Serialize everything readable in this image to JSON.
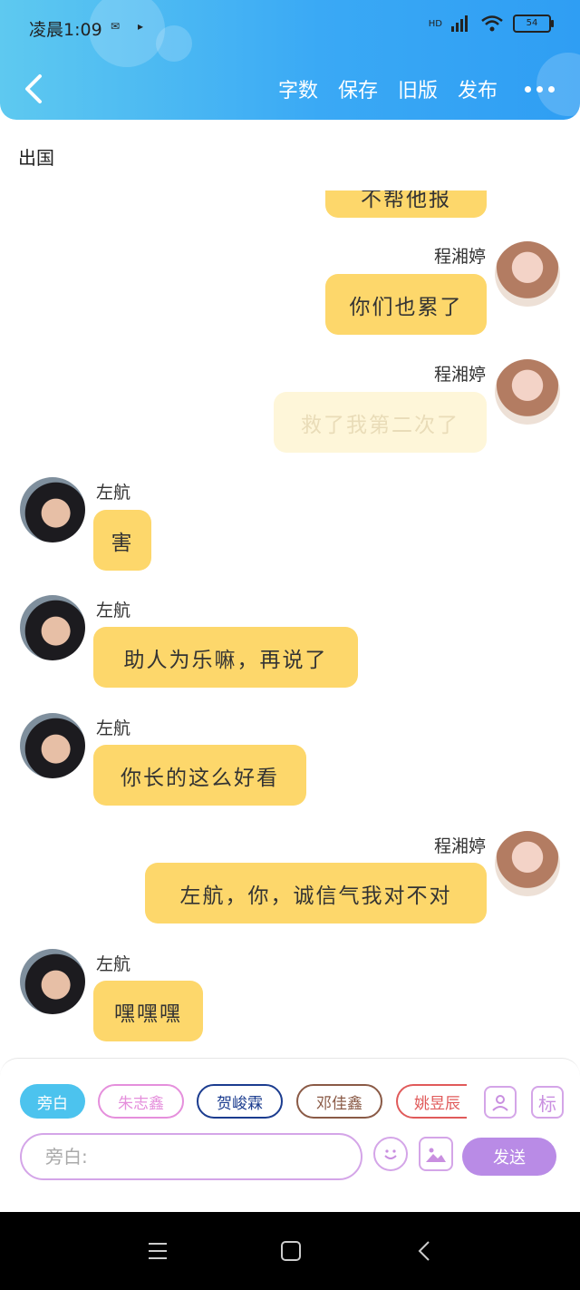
{
  "status_bar": {
    "time": "凌晨1:09",
    "battery": "54",
    "network": "HD"
  },
  "header": {
    "menu": [
      "字数",
      "保存",
      "旧版",
      "发布"
    ]
  },
  "chat": {
    "title": "出国",
    "messages": [
      {
        "side": "right",
        "name": "",
        "text": "不帮他报",
        "partial": true
      },
      {
        "side": "right",
        "name": "程湘婷",
        "text": "你们也累了"
      },
      {
        "side": "right",
        "name": "程湘婷",
        "text": "救了我第二次了",
        "faded": true
      },
      {
        "side": "left",
        "name": "左航",
        "text": "害"
      },
      {
        "side": "left",
        "name": "左航",
        "text": "助人为乐嘛，再说了"
      },
      {
        "side": "left",
        "name": "左航",
        "text": "你长的这么好看"
      },
      {
        "side": "right",
        "name": "程湘婷",
        "text": "左航，你，诚信气我对不对"
      },
      {
        "side": "left",
        "name": "左航",
        "text": "嘿嘿嘿"
      }
    ]
  },
  "composer": {
    "tags": [
      {
        "label": "旁白",
        "color": "#4cc3ee"
      },
      {
        "label": "朱志鑫",
        "color": "#e58fdc"
      },
      {
        "label": "贺峻霖",
        "color": "#1b3c8f"
      },
      {
        "label": "邓佳鑫",
        "color": "#8a5a46"
      },
      {
        "label": "姚昱辰",
        "color": "#e05a5a"
      }
    ],
    "placeholder": "旁白:",
    "send_label": "发送",
    "mark_label": "标"
  }
}
